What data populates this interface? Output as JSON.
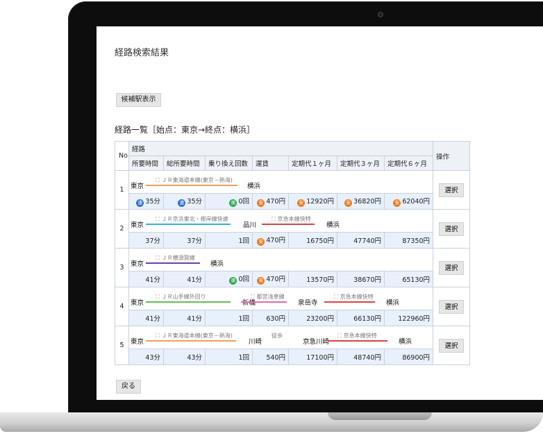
{
  "page": {
    "title": "経路検索結果",
    "candidate_button": "候補駅表示",
    "list_heading": "経路一覧［始点：東京→終点：横浜］",
    "back_button": "戻る"
  },
  "table": {
    "headers": {
      "no": "No",
      "route": "経路",
      "time": "所要時間",
      "total_time": "総所要時間",
      "transfers": "乗り換え回数",
      "fare": "運賃",
      "pass1": "定期代１ヶ月",
      "pass3": "定期代３ヶ月",
      "pass6": "定期代６ヶ月",
      "op": "操作"
    },
    "select_label": "選択",
    "badges": {
      "fast": "速",
      "easy": "楽",
      "cheap": "安"
    },
    "routes": [
      {
        "no": "1",
        "stations": [
          "東京",
          "横浜"
        ],
        "lines": [
          "ＪＲ東海道本線(東京－熱海)"
        ],
        "time": "35分",
        "total_time": "35分",
        "transfers": "0回",
        "fare": "470円",
        "pass1": "12920円",
        "pass3": "36820円",
        "pass6": "62040円"
      },
      {
        "no": "2",
        "stations": [
          "東京",
          "品川",
          "横浜"
        ],
        "lines": [
          "ＪＲ京浜東北・根岸線快速",
          "京急本線快特"
        ],
        "time": "37分",
        "total_time": "37分",
        "transfers": "1回",
        "fare": "470円",
        "pass1": "16750円",
        "pass3": "47740円",
        "pass6": "87350円"
      },
      {
        "no": "3",
        "stations": [
          "東京",
          "横浜"
        ],
        "lines": [
          "ＪＲ横須賀線"
        ],
        "time": "41分",
        "total_time": "41分",
        "transfers": "0回",
        "fare": "470円",
        "pass1": "13570円",
        "pass3": "38670円",
        "pass6": "65130円"
      },
      {
        "no": "4",
        "stations": [
          "東京",
          "新橋",
          "泉岳寺",
          "横浜"
        ],
        "lines": [
          "ＪＲ山手線外回り",
          "都営浅草線",
          "京急本線快特"
        ],
        "time": "41分",
        "total_time": "41分",
        "transfers": "1回",
        "fare": "630円",
        "pass1": "23200円",
        "pass3": "66130円",
        "pass6": "122960円"
      },
      {
        "no": "5",
        "stations": [
          "東京",
          "川崎",
          "京急川崎",
          "横浜"
        ],
        "lines": [
          "ＪＲ東海道本線(東京－熱海)",
          "徒歩",
          "京急本線快特"
        ],
        "time": "43分",
        "total_time": "43分",
        "transfers": "1回",
        "fare": "540円",
        "pass1": "17100円",
        "pass3": "48740円",
        "pass6": "86900円"
      }
    ]
  },
  "colors": {
    "jr_tokaido": "#f0a060",
    "keihin_tohoku": "#33b0e0",
    "keikyu": "#e04040",
    "yokosuka": "#6a3fb0",
    "yamanote": "#5cc050",
    "asakusa": "#e26aa0",
    "fast_badge": "#2d6fd6",
    "easy_badge": "#2fa84f",
    "cheap_badge": "#f07a1a"
  }
}
